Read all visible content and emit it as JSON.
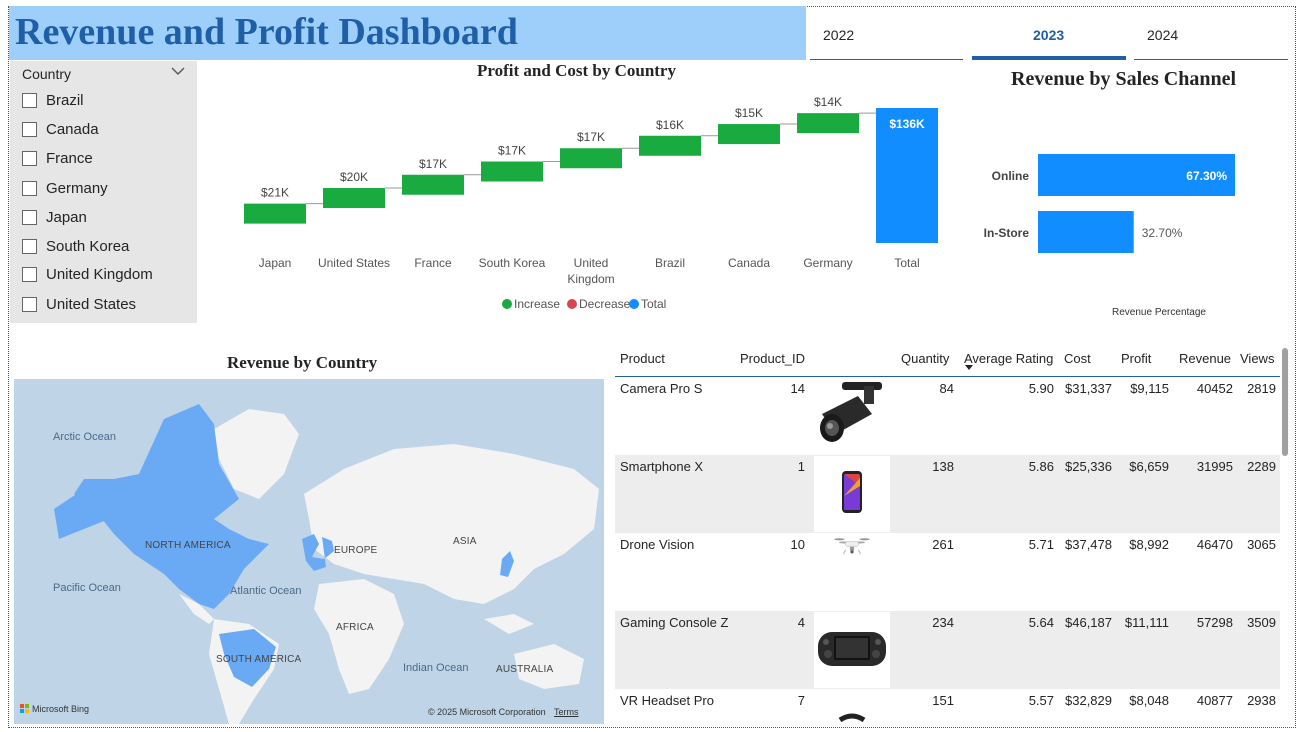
{
  "header": {
    "title": "Revenue and Profit Dashboard"
  },
  "year_tabs": [
    {
      "label": "2022",
      "active": false
    },
    {
      "label": "2023",
      "active": true
    },
    {
      "label": "2024",
      "active": false
    }
  ],
  "slicer": {
    "title": "Country",
    "items": [
      "Brazil",
      "Canada",
      "France",
      "Germany",
      "Japan",
      "South Korea",
      "United Kingdom",
      "United States"
    ]
  },
  "waterfall": {
    "title": "Profit and Cost by Country",
    "legend": [
      "Increase",
      "Decrease",
      "Total"
    ],
    "colors": {
      "increase": "#1aab40",
      "decrease": "#d64550",
      "total": "#118dff"
    }
  },
  "channel": {
    "title": "Revenue by Sales Channel",
    "axis_label": "Revenue Percentage",
    "color": "#118dff"
  },
  "map": {
    "title": "Revenue by Country",
    "labels": {
      "arctic": "Arctic Ocean",
      "north_america": "NORTH AMERICA",
      "europe": "EUROPE",
      "asia": "ASIA",
      "pacific": "Pacific Ocean",
      "atlantic": "Atlantic Ocean",
      "africa": "AFRICA",
      "south_america": "SOUTH AMERICA",
      "indian": "Indian Ocean",
      "australia": "AUSTRALIA"
    },
    "credit_left": "Microsoft Bing",
    "credit_right": "© 2025 Microsoft Corporation",
    "terms": "Terms",
    "highlight_color": "#6aaaf5"
  },
  "table": {
    "headers": {
      "product": "Product",
      "product_id": "Product_ID",
      "quantity": "Quantity",
      "rating": "Average Rating",
      "cost": "Cost",
      "profit": "Profit",
      "revenue": "Revenue",
      "views": "Views"
    },
    "rows": [
      {
        "product": "Camera Pro S",
        "product_id": "14",
        "quantity": "84",
        "rating": "5.90",
        "cost": "$31,337",
        "profit": "$9,115",
        "revenue": "40452",
        "views": "2819",
        "image": "camera-icon"
      },
      {
        "product": "Smartphone X",
        "product_id": "1",
        "quantity": "138",
        "rating": "5.86",
        "cost": "$25,336",
        "profit": "$6,659",
        "revenue": "31995",
        "views": "2289",
        "image": "smartphone-icon"
      },
      {
        "product": "Drone Vision",
        "product_id": "10",
        "quantity": "261",
        "rating": "5.71",
        "cost": "$37,478",
        "profit": "$8,992",
        "revenue": "46470",
        "views": "3065",
        "image": "drone-icon"
      },
      {
        "product": "Gaming Console Z",
        "product_id": "4",
        "quantity": "234",
        "rating": "5.64",
        "cost": "$46,187",
        "profit": "$11,111",
        "revenue": "57298",
        "views": "3509",
        "image": "console-icon"
      },
      {
        "product": "VR Headset Pro",
        "product_id": "7",
        "quantity": "151",
        "rating": "5.57",
        "cost": "$32,829",
        "profit": "$8,048",
        "revenue": "40877",
        "views": "2938",
        "image": "headset-icon"
      }
    ]
  },
  "chart_data": [
    {
      "type": "bar",
      "subtype": "waterfall",
      "title": "Profit and Cost by Country",
      "categories": [
        "Japan",
        "United States",
        "France",
        "South Korea",
        "United Kingdom",
        "Brazil",
        "Canada",
        "Germany",
        "Total"
      ],
      "values": [
        21,
        20,
        17,
        17,
        17,
        16,
        15,
        14,
        136
      ],
      "data_labels": [
        "$21K",
        "$20K",
        "$17K",
        "$17K",
        "$17K",
        "$16K",
        "$15K",
        "$14K",
        "$136K"
      ],
      "legend": [
        "Increase",
        "Decrease",
        "Total"
      ],
      "legend_position": "bottom",
      "grid": false
    },
    {
      "type": "bar",
      "orientation": "horizontal",
      "title": "Revenue by Sales Channel",
      "categories": [
        "Online",
        "In-Store"
      ],
      "values": [
        67.3,
        32.7
      ],
      "data_labels": [
        "67.30%",
        "32.70%"
      ],
      "xlabel": "Revenue Percentage",
      "grid": false
    }
  ]
}
